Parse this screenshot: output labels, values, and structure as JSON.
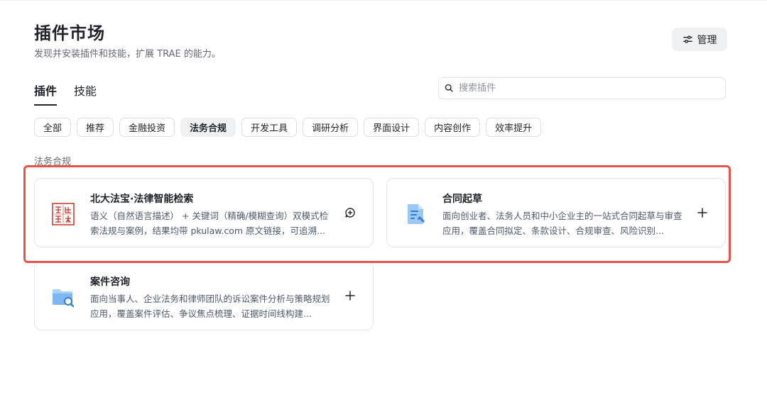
{
  "header": {
    "title": "插件市场",
    "subtitle": "发现并安装插件和技能，扩展 TRAE 的能力。",
    "manage_label": "管理"
  },
  "tabs": [
    {
      "label": "插件",
      "active": true
    },
    {
      "label": "技能",
      "active": false
    }
  ],
  "search": {
    "placeholder": "搜索插件",
    "value": ""
  },
  "filters": [
    {
      "label": "全部",
      "active": false
    },
    {
      "label": "推荐",
      "active": false
    },
    {
      "label": "金融投资",
      "active": false
    },
    {
      "label": "法务合规",
      "active": true
    },
    {
      "label": "开发工具",
      "active": false
    },
    {
      "label": "调研分析",
      "active": false
    },
    {
      "label": "界面设计",
      "active": false
    },
    {
      "label": "内容创作",
      "active": false
    },
    {
      "label": "效率提升",
      "active": false
    }
  ],
  "section_label": "法务合规",
  "plugins": [
    {
      "name": "北大法宝·法律智能检索",
      "description": "语义（自然语言描述） + 关键词（精确/模糊查询）双模式检索法规与案例，结果均带 pkulaw.com 原文链接，可追溯...",
      "icon": "pkulaw-seal-icon",
      "action": "installed-chat-icon"
    },
    {
      "name": "合同起草",
      "description": "面向创业者、法务人员和中小企业主的一站式合同起草与审查应用，覆盖合同拟定、条款设计、合规审查、风险识别...",
      "icon": "contract-document-icon",
      "action": "add-icon"
    },
    {
      "name": "案件咨询",
      "description": "面向当事人、企业法务和律师团队的诉讼案件分析与策略规划应用，覆盖案件评估、争议焦点梳理、证据时间线构建...",
      "icon": "folder-search-icon",
      "action": "add-icon"
    }
  ],
  "colors": {
    "highlight_border": "#e5534b",
    "seal_red": "#c0392b",
    "doc_blue": "#2f7fd8",
    "folder_blue": "#5aa3e8"
  }
}
